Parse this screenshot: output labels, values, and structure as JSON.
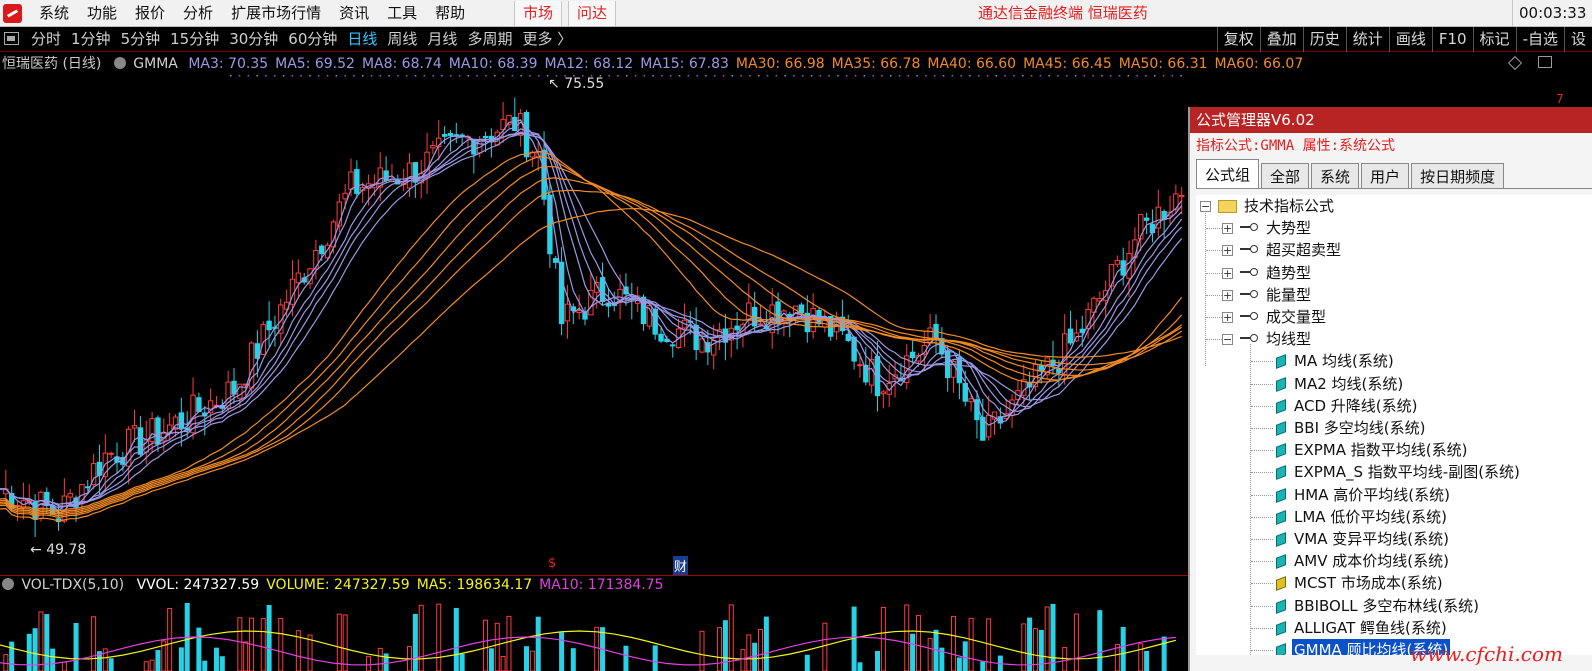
{
  "menubar": {
    "items": [
      "系统",
      "功能",
      "报价",
      "分析",
      "扩展市场行情",
      "资讯",
      "工具",
      "帮助"
    ],
    "market_btn": "市场",
    "wenda_btn": "问达",
    "app_title": "通达信金融终端  恒瑞医药",
    "clock": "00:03:33"
  },
  "periodbar": {
    "tabs": [
      "分时",
      "1分钟",
      "5分钟",
      "15分钟",
      "30分钟",
      "60分钟",
      "日线",
      "周线",
      "月线",
      "多周期",
      "更多 〉"
    ],
    "active": "日线",
    "right_tools": [
      "复权",
      "叠加",
      "历史",
      "统计",
      "画线",
      "F10",
      "标记",
      "-自选",
      "设"
    ]
  },
  "chart_header": {
    "stock": "恒瑞医药 (日线)",
    "indicator": "GMMA",
    "ma_items": [
      {
        "label": "MA3: 70.35",
        "color": "#9c98e6"
      },
      {
        "label": "MA5: 69.52",
        "color": "#9c98e6"
      },
      {
        "label": "MA8: 68.74",
        "color": "#9c98e6"
      },
      {
        "label": "MA10: 68.39",
        "color": "#9c98e6"
      },
      {
        "label": "MA12: 68.12",
        "color": "#9c98e6"
      },
      {
        "label": "MA15: 67.83",
        "color": "#9c98e6"
      },
      {
        "label": "MA30: 66.98",
        "color": "#f28a24"
      },
      {
        "label": "MA35: 66.78",
        "color": "#f28a24"
      },
      {
        "label": "MA40: 66.60",
        "color": "#f28a24"
      },
      {
        "label": "MA45: 66.45",
        "color": "#f28a24"
      },
      {
        "label": "MA50: 66.31",
        "color": "#f28a24"
      },
      {
        "label": "MA60: 66.07",
        "color": "#f28a24"
      }
    ]
  },
  "price_chart": {
    "high_label": "75.55",
    "low_label": "49.78",
    "marker_s": "$",
    "marker_cai": "财",
    "right_edge_value": "7",
    "colors": {
      "up": "#ff3c3c",
      "down": "#27d2e6",
      "short_ma": "#9c98e6",
      "long_ma": "#f28a24"
    }
  },
  "volume_header": {
    "name": "VOL-TDX(5,10)",
    "items": [
      {
        "label": "VVOL: 247327.59",
        "color": "#ffffff"
      },
      {
        "label": "VOLUME: 247327.59",
        "color": "#f5f514"
      },
      {
        "label": "MA5: 198634.17",
        "color": "#f5f514"
      },
      {
        "label": "MA10: 171384.75",
        "color": "#e040e0"
      }
    ]
  },
  "formula_manager": {
    "title": "公式管理器V6.02",
    "info": "指标公式:GMMA 属性:系统公式",
    "tabs": [
      "公式组",
      "全部",
      "系统",
      "用户",
      "按日期频度"
    ],
    "active_tab": "公式组",
    "root": "技术指标公式",
    "groups": [
      "大势型",
      "超买超卖型",
      "趋势型",
      "能量型",
      "成交量型",
      "均线型"
    ],
    "leaves": [
      {
        "label": "MA  均线(系统)",
        "icon": "teal"
      },
      {
        "label": "MA2  均线(系统)",
        "icon": "teal"
      },
      {
        "label": "ACD  升降线(系统)",
        "icon": "teal"
      },
      {
        "label": "BBI  多空均线(系统)",
        "icon": "teal"
      },
      {
        "label": "EXPMA  指数平均线(系统)",
        "icon": "teal"
      },
      {
        "label": "EXPMA_S  指数平均线-副图(系统)",
        "icon": "teal"
      },
      {
        "label": "HMA  高价平均线(系统)",
        "icon": "teal"
      },
      {
        "label": "LMA  低价平均线(系统)",
        "icon": "teal"
      },
      {
        "label": "VMA  变异平均线(系统)",
        "icon": "teal"
      },
      {
        "label": "AMV  成本价均线(系统)",
        "icon": "teal"
      },
      {
        "label": "MCST  市场成本(系统)",
        "icon": "yellow"
      },
      {
        "label": "BBIBOLL  多空布林线(系统)",
        "icon": "teal"
      },
      {
        "label": "ALLIGAT  鳄鱼线(系统)",
        "icon": "teal"
      },
      {
        "label": "GMMA  顾比均线(系统)",
        "icon": "teal"
      }
    ],
    "selected": "GMMA  顾比均线(系统)"
  },
  "watermark": "www.cfchi.com"
}
